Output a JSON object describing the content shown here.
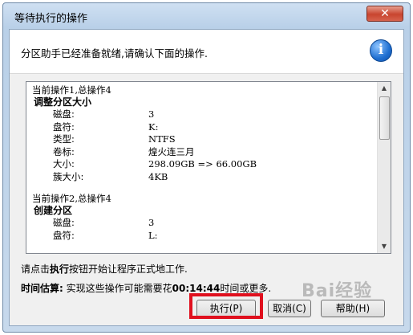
{
  "window": {
    "title": "等待执行的操作",
    "close_label": "✕"
  },
  "header": {
    "message": "分区助手已经准备就绪,请确认下面的操作."
  },
  "operations": [
    {
      "header": "当前操作1,总操作4",
      "title": "调整分区大小",
      "props": [
        {
          "key": "磁盘:",
          "value": "3"
        },
        {
          "key": "盘符:",
          "value": "K:"
        },
        {
          "key": "类型:",
          "value": "NTFS"
        },
        {
          "key": "卷标:",
          "value": "煌火连三月"
        },
        {
          "key": "大小:",
          "value": "298.09GB => 66.00GB"
        },
        {
          "key": "簇大小:",
          "value": "4KB"
        }
      ]
    },
    {
      "header": "当前操作2,总操作4",
      "title": "创建分区",
      "props": [
        {
          "key": "磁盘:",
          "value": "3"
        },
        {
          "key": "盘符:",
          "value": "L:"
        }
      ]
    }
  ],
  "notes": {
    "line1_prefix": "请点击",
    "line1_bold": "执行",
    "line1_suffix": "按钮开始让程序正式地工作.",
    "line2_bold": "时间估算:",
    "line2_text": " 实现这些操作可能需要花",
    "line2_time": "00:14:44",
    "line2_suffix": "时间或更多."
  },
  "buttons": {
    "execute": "执行(P)",
    "cancel": "取消(C)",
    "help": "帮助(H)"
  },
  "watermark": "Bai经验",
  "colors": {
    "highlight": "#e0101e",
    "close_button": "#c8452f"
  }
}
